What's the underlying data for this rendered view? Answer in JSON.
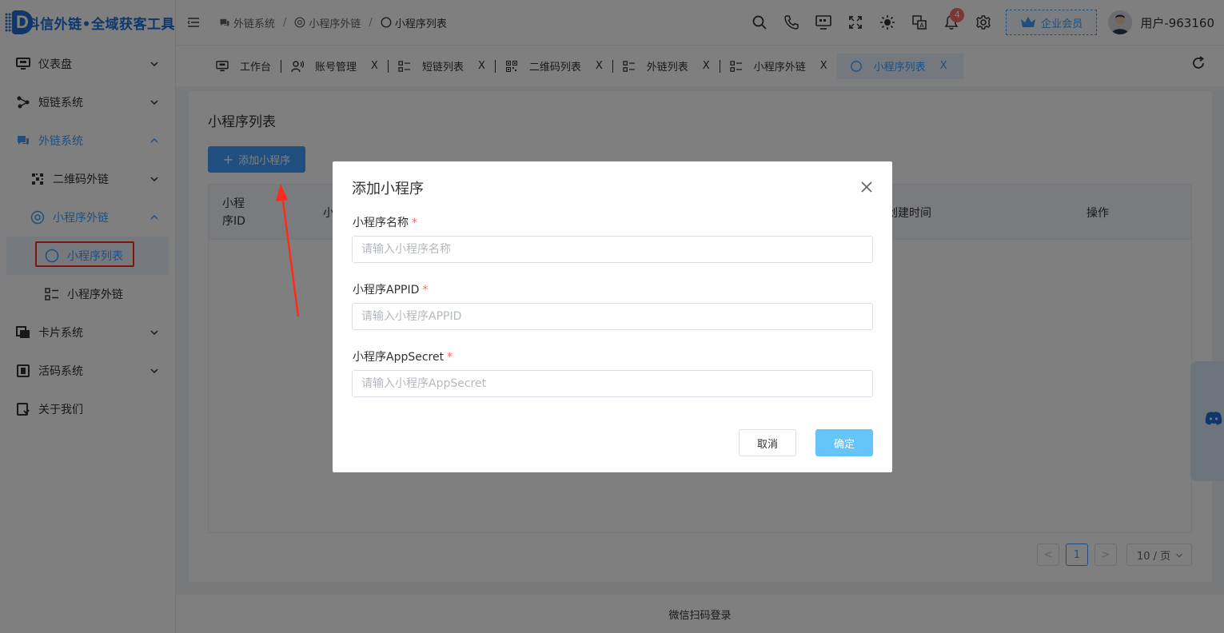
{
  "app": {
    "logo_letter": "D",
    "title": "抖信外链•全域获客工具"
  },
  "sidebar": {
    "items": [
      {
        "label": "仪表盘",
        "icon": "monitor-icon"
      },
      {
        "label": "短链系统",
        "icon": "share-icon"
      },
      {
        "label": "外链系统",
        "icon": "chat-icon"
      },
      {
        "label": "二维码外链",
        "icon": "qrcode-icon"
      },
      {
        "label": "小程序外链",
        "icon": "target-icon"
      },
      {
        "label": "小程序列表",
        "icon": "circle-icon"
      },
      {
        "label": "小程序外链",
        "icon": "list-icon"
      },
      {
        "label": "卡片系统",
        "icon": "card-icon"
      },
      {
        "label": "活码系统",
        "icon": "code-icon"
      },
      {
        "label": "关于我们",
        "icon": "info-icon"
      }
    ]
  },
  "breadcrumb": [
    {
      "label": "外链系统",
      "icon": "chat-icon"
    },
    {
      "label": "小程序外链",
      "icon": "target-icon"
    },
    {
      "label": "小程序列表",
      "icon": "circle-icon"
    }
  ],
  "header": {
    "notification_count": "4",
    "vip_label": "企业会员",
    "username": "用户-963160"
  },
  "tabs": [
    {
      "label": "工作台",
      "icon": "monitor-icon",
      "closable": false
    },
    {
      "label": "账号管理",
      "icon": "user-icon",
      "closable": true
    },
    {
      "label": "短链列表",
      "icon": "list-icon",
      "closable": true
    },
    {
      "label": "二维码列表",
      "icon": "qrcode-icon",
      "closable": true
    },
    {
      "label": "外链列表",
      "icon": "list-icon",
      "closable": true
    },
    {
      "label": "小程序外链",
      "icon": "list-icon",
      "closable": true
    },
    {
      "label": "小程序列表",
      "icon": "circle-icon",
      "closable": true,
      "active": true
    }
  ],
  "tab_close_glyph": "X",
  "page": {
    "title": "小程序列表",
    "add_button": "添加小程序",
    "table_headers": [
      "小程\n序ID",
      "小",
      "创建时间",
      "操作"
    ]
  },
  "pagination": {
    "prev": "<",
    "current": "1",
    "next": ">",
    "page_size": "10 / 页"
  },
  "footer": {
    "text": "微信扫码登录"
  },
  "dialog": {
    "title": "添加小程序",
    "fields": [
      {
        "label": "小程序名称",
        "required": "*",
        "placeholder": "请输入小程序名称",
        "value": ""
      },
      {
        "label": "小程序APPID",
        "required": "*",
        "placeholder": "请输入小程序APPID",
        "value": ""
      },
      {
        "label": "小程序AppSecret",
        "required": "*",
        "placeholder": "请输入小程序AppSecret",
        "value": ""
      }
    ],
    "cancel": "取消",
    "confirm": "确定"
  },
  "colors": {
    "accent": "#409eff",
    "annotation": "#ff2a1a",
    "overlay": "rgba(0,0,0,0.5)"
  }
}
